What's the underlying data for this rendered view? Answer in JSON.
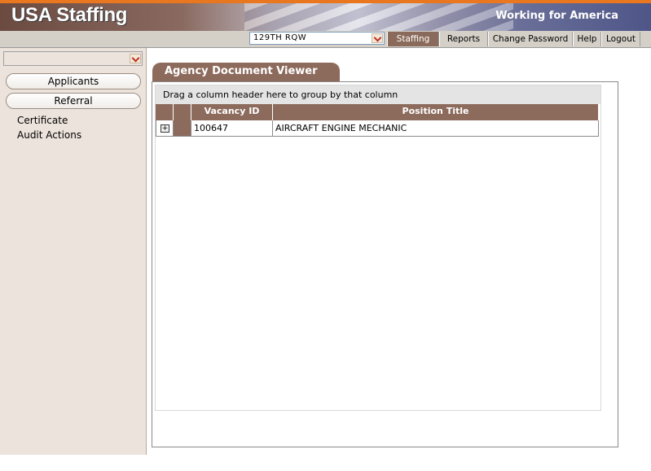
{
  "header": {
    "brand": "USA Staffing",
    "tagline": "Working for America"
  },
  "nav": {
    "org_select": "129TH RQW",
    "tabs": [
      {
        "label": "Staffing",
        "active": true
      },
      {
        "label": "Reports",
        "active": false
      },
      {
        "label": "Change Password",
        "active": false
      },
      {
        "label": "Help",
        "active": false
      },
      {
        "label": "Logout",
        "active": false
      }
    ]
  },
  "sidebar": {
    "select_value": "",
    "buttons": [
      "Applicants",
      "Referral"
    ],
    "links": [
      "Certificate",
      "Audit Actions"
    ]
  },
  "main": {
    "panel_title": "Agency Document Viewer",
    "group_hint": "Drag a column header here to group by that column",
    "columns": [
      "Vacancy ID",
      "Position Title"
    ],
    "rows": [
      {
        "vacancy_id": "100647",
        "position_title": "AIRCRAFT ENGINE MECHANIC"
      }
    ],
    "expander_symbol": "+"
  },
  "colors": {
    "accent_brown": "#8c6a5c",
    "top_stripe": "#e8771f",
    "sidebar_bg": "#ebe3dc"
  }
}
